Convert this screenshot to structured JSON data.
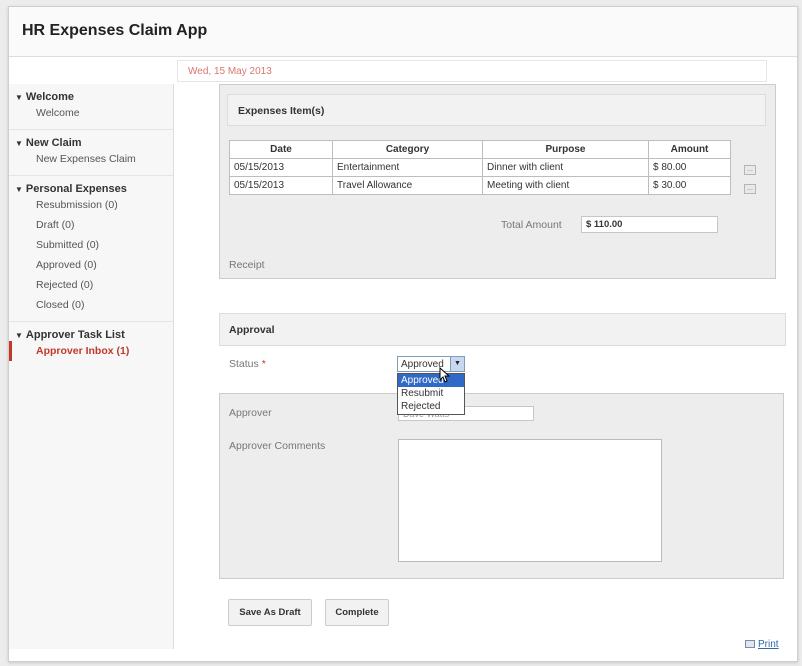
{
  "app": {
    "title": "HR Expenses Claim App"
  },
  "date": "Wed, 15 May 2013",
  "sidebar": {
    "groups": [
      {
        "label": "Welcome",
        "items": [
          {
            "label": "Welcome"
          }
        ]
      },
      {
        "label": "New Claim",
        "items": [
          {
            "label": "New Expenses Claim"
          }
        ]
      },
      {
        "label": "Personal Expenses",
        "items": [
          {
            "label": "Resubmission (0)"
          },
          {
            "label": "Draft (0)"
          },
          {
            "label": "Submitted (0)"
          },
          {
            "label": "Approved (0)"
          },
          {
            "label": "Rejected (0)"
          },
          {
            "label": "Closed (0)"
          }
        ]
      },
      {
        "label": "Approver Task List",
        "items": [
          {
            "label": "Approver Inbox (1)",
            "active": true
          }
        ]
      }
    ]
  },
  "expenses": {
    "section_title": "Expenses Item(s)",
    "columns": [
      "Date",
      "Category",
      "Purpose",
      "Amount"
    ],
    "rows": [
      [
        "05/15/2013",
        "Entertainment",
        "Dinner with client",
        "$ 80.00"
      ],
      [
        "05/15/2013",
        "Travel Allowance",
        "Meeting with client",
        "$ 30.00"
      ]
    ],
    "row_button": "...",
    "total_label": "Total Amount",
    "total_value": "$ 110.00",
    "receipt_label": "Receipt"
  },
  "approval": {
    "section_title": "Approval",
    "status_label": "Status",
    "required_marker": "*",
    "status_value": "Approved",
    "status_options": [
      "Approved",
      "Resubmit",
      "Rejected"
    ],
    "highlighted_option": 0,
    "approver_label": "Approver",
    "approver_value": "Dave Watts",
    "comments_label": "Approver Comments",
    "comments_value": ""
  },
  "buttons": {
    "save_draft": "Save As Draft",
    "complete": "Complete"
  },
  "footer": {
    "print": "Print"
  },
  "colors": {
    "accent_red": "#c0392b",
    "date_text": "#d8776f",
    "selection_blue": "#3169c6",
    "link_blue": "#2c6aa8"
  }
}
